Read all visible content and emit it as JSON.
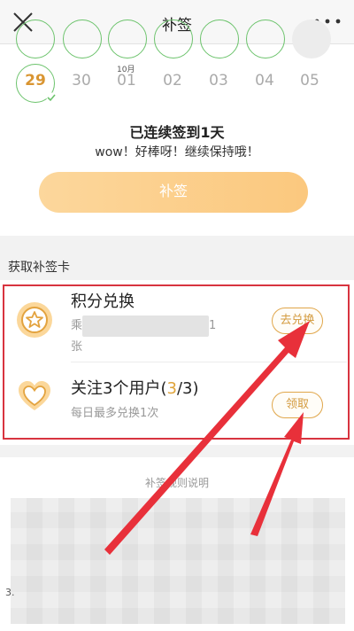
{
  "nav": {
    "title": "补签",
    "close_icon": "close-icon",
    "more_icon": "more-icon"
  },
  "calendar": {
    "days": [
      "29",
      "30",
      "01",
      "02",
      "03",
      "04",
      "05"
    ],
    "active_day": "29",
    "month_label": "10月"
  },
  "status": {
    "headline": "已连续签到1天",
    "encourage": "wow！好棒呀！继续保持哦！"
  },
  "makeup_button": "补签",
  "section_title": "获取补签卡",
  "cards": [
    {
      "icon": "star-icon",
      "title": "积分兑换",
      "desc_start": "乘",
      "desc_end": "1",
      "desc_line2": "张",
      "action": "去兑换"
    },
    {
      "icon": "heart-icon",
      "title_prefix": "关注3个用户(",
      "count": "3",
      "title_suffix": "/3)",
      "desc": "每日最多兑换1次",
      "action": "领取"
    }
  ],
  "rules": {
    "title": "补签规则说明",
    "item_number": "3."
  },
  "colors": {
    "accent": "#e0a64a",
    "check_green": "#6cc36c",
    "annotation_red": "#e8303a"
  }
}
